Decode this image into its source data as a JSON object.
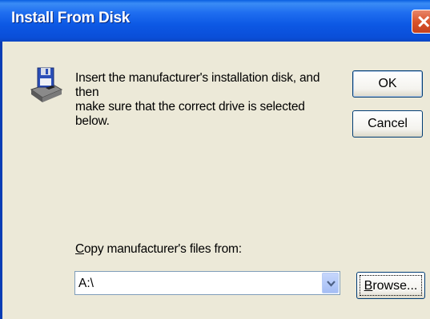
{
  "window": {
    "title": "Install From Disk",
    "close_glyph": "✕"
  },
  "message": {
    "line1": "Insert the manufacturer's installation disk, and then",
    "line2": "make sure that the correct drive is selected below."
  },
  "buttons": {
    "ok": "OK",
    "cancel": "Cancel",
    "browse_mnemonic": "B",
    "browse_rest": "rowse..."
  },
  "copy_from": {
    "label_mnemonic": "C",
    "label_rest": "opy manufacturer's files from:",
    "value": "A:\\"
  },
  "icons": {
    "disk": "floppy-disk-drive-icon",
    "dropdown": "chevron-down-icon"
  },
  "colors": {
    "titlebar": "#0c58e4",
    "dialog_bg": "#ece9d8",
    "close_button": "#d9542c"
  }
}
